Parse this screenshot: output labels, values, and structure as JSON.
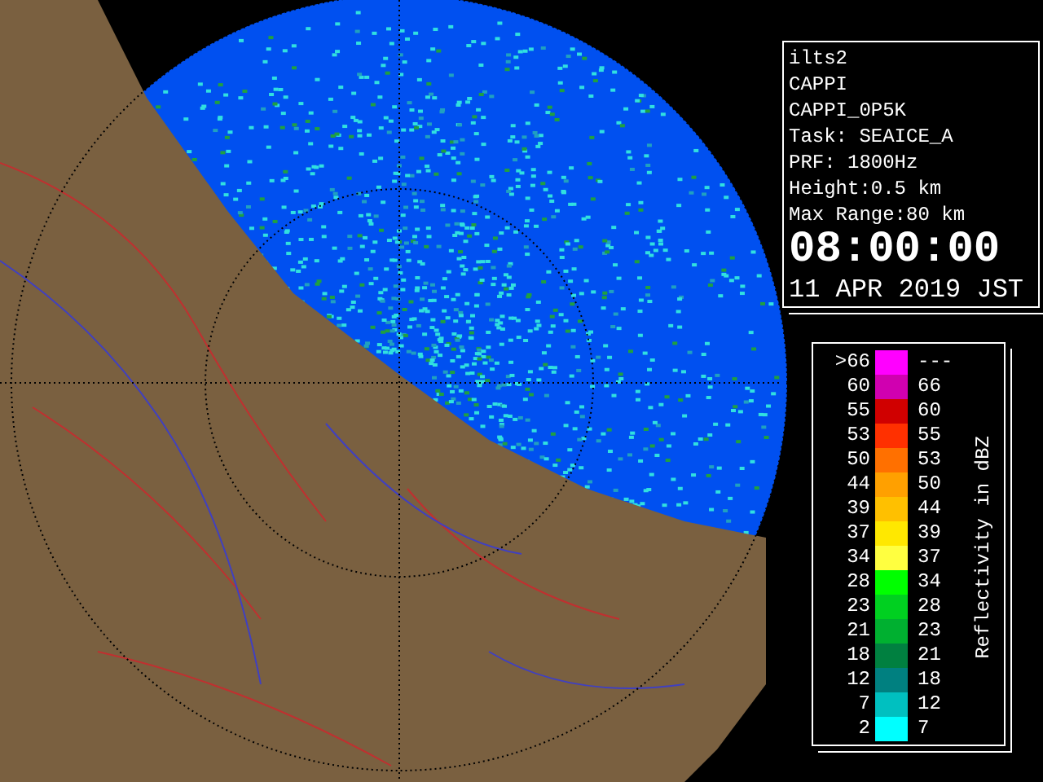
{
  "info": {
    "lines": [
      "ilts2",
      "CAPPI",
      "CAPPI_0P5K",
      "Task: SEAICE_A",
      "PRF: 1800Hz",
      "Height:0.5 km",
      "Max Range:80 km"
    ],
    "time": "08:00:00",
    "date": "11 APR 2019 JST"
  },
  "legend": {
    "title": "Reflectivity in dBZ",
    "rows": [
      {
        "low": ">66",
        "high": "---",
        "color": "#ff00ff"
      },
      {
        "low": "60",
        "high": "66",
        "color": "#d000b0"
      },
      {
        "low": "55",
        "high": "60",
        "color": "#d00000"
      },
      {
        "low": "53",
        "high": "55",
        "color": "#ff3000"
      },
      {
        "low": "50",
        "high": "53",
        "color": "#ff7000"
      },
      {
        "low": "44",
        "high": "50",
        "color": "#ffa000"
      },
      {
        "low": "39",
        "high": "44",
        "color": "#ffc000"
      },
      {
        "low": "37",
        "high": "39",
        "color": "#ffe800"
      },
      {
        "low": "34",
        "high": "37",
        "color": "#ffff40"
      },
      {
        "low": "28",
        "high": "34",
        "color": "#00ff00"
      },
      {
        "low": "23",
        "high": "28",
        "color": "#00d020"
      },
      {
        "low": "21",
        "high": "23",
        "color": "#00b030"
      },
      {
        "low": "18",
        "high": "21",
        "color": "#008040"
      },
      {
        "low": "12",
        "high": "18",
        "color": "#008080"
      },
      {
        "low": "7",
        "high": "12",
        "color": "#00c0c0"
      },
      {
        "low": "2",
        "high": "7",
        "color": "#00ffff"
      }
    ]
  }
}
